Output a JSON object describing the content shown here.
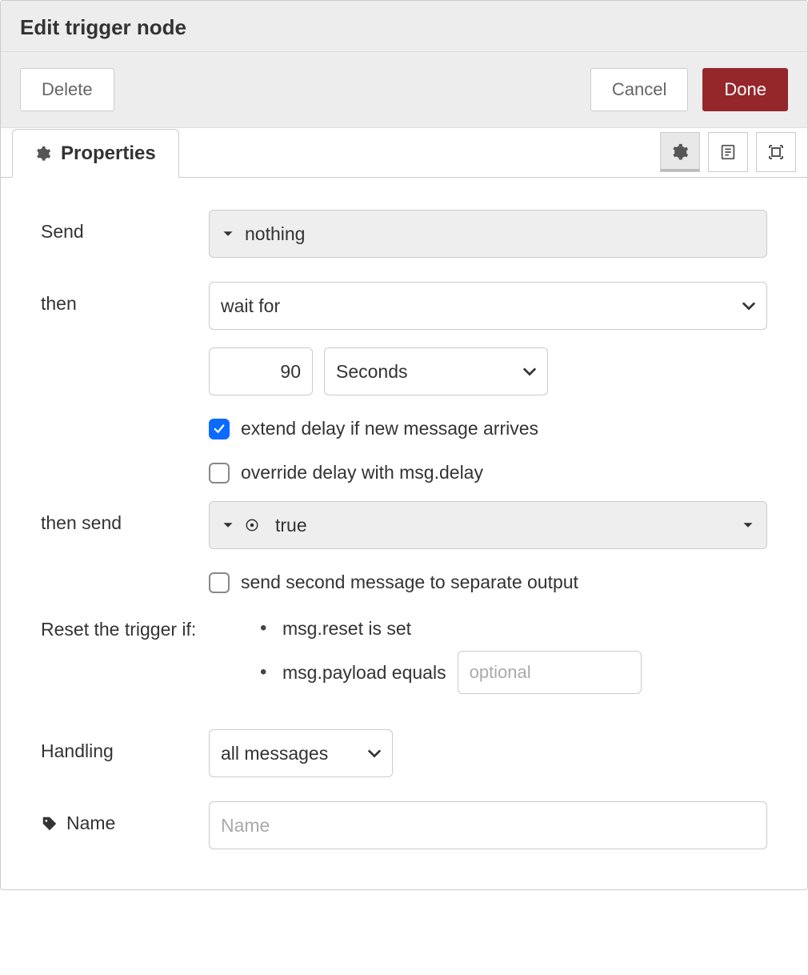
{
  "dialog": {
    "title": "Edit trigger node"
  },
  "toolbar": {
    "delete_label": "Delete",
    "cancel_label": "Cancel",
    "done_label": "Done"
  },
  "tabs": {
    "properties_label": "Properties"
  },
  "form": {
    "send": {
      "label": "Send",
      "value": "nothing"
    },
    "then": {
      "label": "then",
      "value": "wait for",
      "duration": "90",
      "units": "Seconds",
      "extend_checked": true,
      "extend_label": "extend delay if new message arrives",
      "override_checked": false,
      "override_label": "override delay with msg.delay"
    },
    "then_send": {
      "label": "then send",
      "value": "true",
      "separate_checked": false,
      "separate_label": "send second message to separate output"
    },
    "reset": {
      "label": "Reset the trigger if:",
      "item1": "msg.reset is set",
      "item2_prefix": "msg.payload equals",
      "item2_placeholder": "optional"
    },
    "handling": {
      "label": "Handling",
      "value": "all messages"
    },
    "name": {
      "label": "Name",
      "placeholder": "Name",
      "value": ""
    }
  }
}
